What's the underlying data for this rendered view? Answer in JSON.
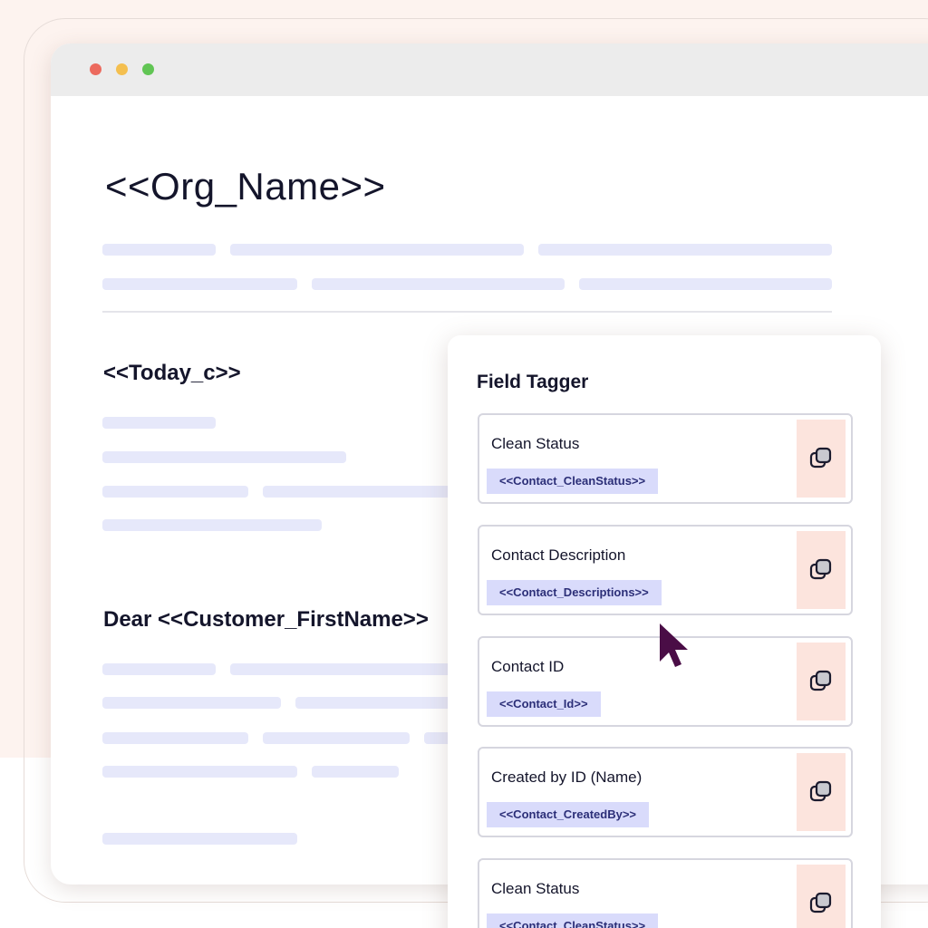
{
  "document": {
    "title": "<<Org_Name>>",
    "date_field": "<<Today_c>>",
    "greeting": "Dear <<Customer_FirstName>>"
  },
  "field_tagger": {
    "title": "Field Tagger",
    "fields": [
      {
        "label": "Clean Status",
        "tag": "<<Contact_CleanStatus>>"
      },
      {
        "label": "Contact Description",
        "tag": "<<Contact_Descriptions>>"
      },
      {
        "label": "Contact ID",
        "tag": "<<Contact_Id>>"
      },
      {
        "label": "Created by ID (Name)",
        "tag": "<<Contact_CreatedBy>>"
      },
      {
        "label": "Clean Status",
        "tag": "<<Contact_CleanStatus>>"
      }
    ],
    "copy_icon": "copy-icon"
  },
  "colors": {
    "background": "#fdf3ef",
    "placeholder_bar": "#e6e8fa",
    "tag_bg": "#d9dbfb",
    "tag_text": "#2c2f78",
    "copy_button_bg": "#fce4dd",
    "cursor": "#4a0d46"
  }
}
